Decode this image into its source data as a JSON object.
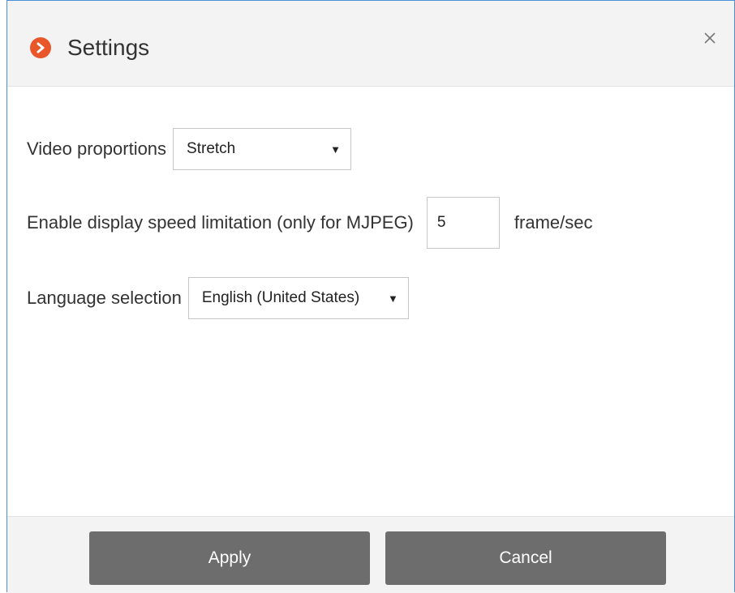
{
  "dialog": {
    "title": "Settings",
    "icon": "chevron-right-circle-icon",
    "accent_color": "#e8562a",
    "close_icon": "close-icon"
  },
  "settings": {
    "video_proportions": {
      "label": "Video proportions",
      "value": "Stretch"
    },
    "speed_limit": {
      "label": "Enable display speed limitation (only for MJPEG)",
      "value": "5",
      "unit": "frame/sec"
    },
    "language": {
      "label": "Language selection",
      "value": "English (United States)"
    }
  },
  "footer": {
    "apply_label": "Apply",
    "cancel_label": "Cancel"
  }
}
